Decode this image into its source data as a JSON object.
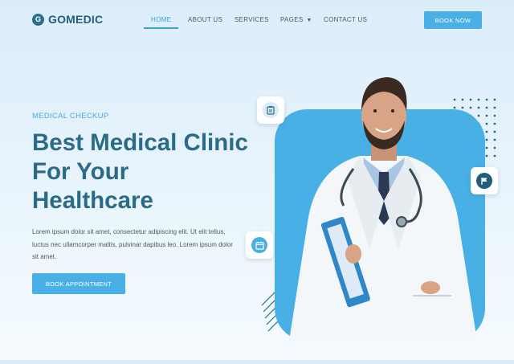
{
  "brand": {
    "mark": "G",
    "name": "GOMEDIC"
  },
  "nav": {
    "items": [
      {
        "label": "HOME",
        "active": true
      },
      {
        "label": "ABOUT US"
      },
      {
        "label": "SERVICES"
      },
      {
        "label": "PAGES",
        "has_dropdown": true
      },
      {
        "label": "CONTACT US"
      }
    ],
    "cta": "BOOK NOW"
  },
  "hero": {
    "eyebrow": "MEDICAL CHECKUP",
    "title": "Best Medical Clinic For Your Healthcare",
    "description": "Lorem ipsum dolor sit amet, consectetur adipiscing elit. Ut elit tellus, luctus nec ullamcorper mattis, pulvinar dapibus leo. Lorem ipsum dolor sit amet.",
    "cta": "BOOK APPOINTMENT"
  },
  "floating_icons": [
    "clipboard-icon",
    "calendar-icon",
    "flag-icon"
  ],
  "colors": {
    "primary": "#49b0e6",
    "heading": "#2a6b87",
    "dark": "#1f5f7d",
    "bg": "#dcedfa"
  }
}
